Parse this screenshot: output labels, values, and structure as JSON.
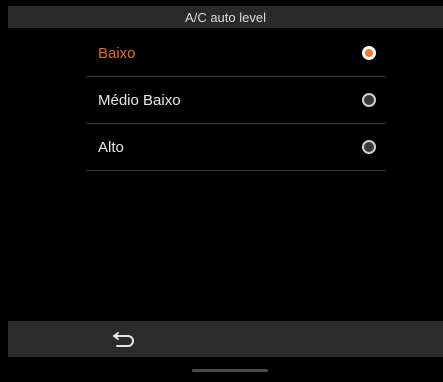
{
  "header": {
    "title": "A/C auto level"
  },
  "options": [
    {
      "label": "Baixo",
      "selected": true
    },
    {
      "label": "Médio Baixo",
      "selected": false
    },
    {
      "label": "Alto",
      "selected": false
    }
  ],
  "footer": {
    "back_icon": "back-arrow-icon"
  },
  "colors": {
    "accent": "#e06a2a",
    "background": "#000000",
    "bar": "#2a2a2a"
  }
}
